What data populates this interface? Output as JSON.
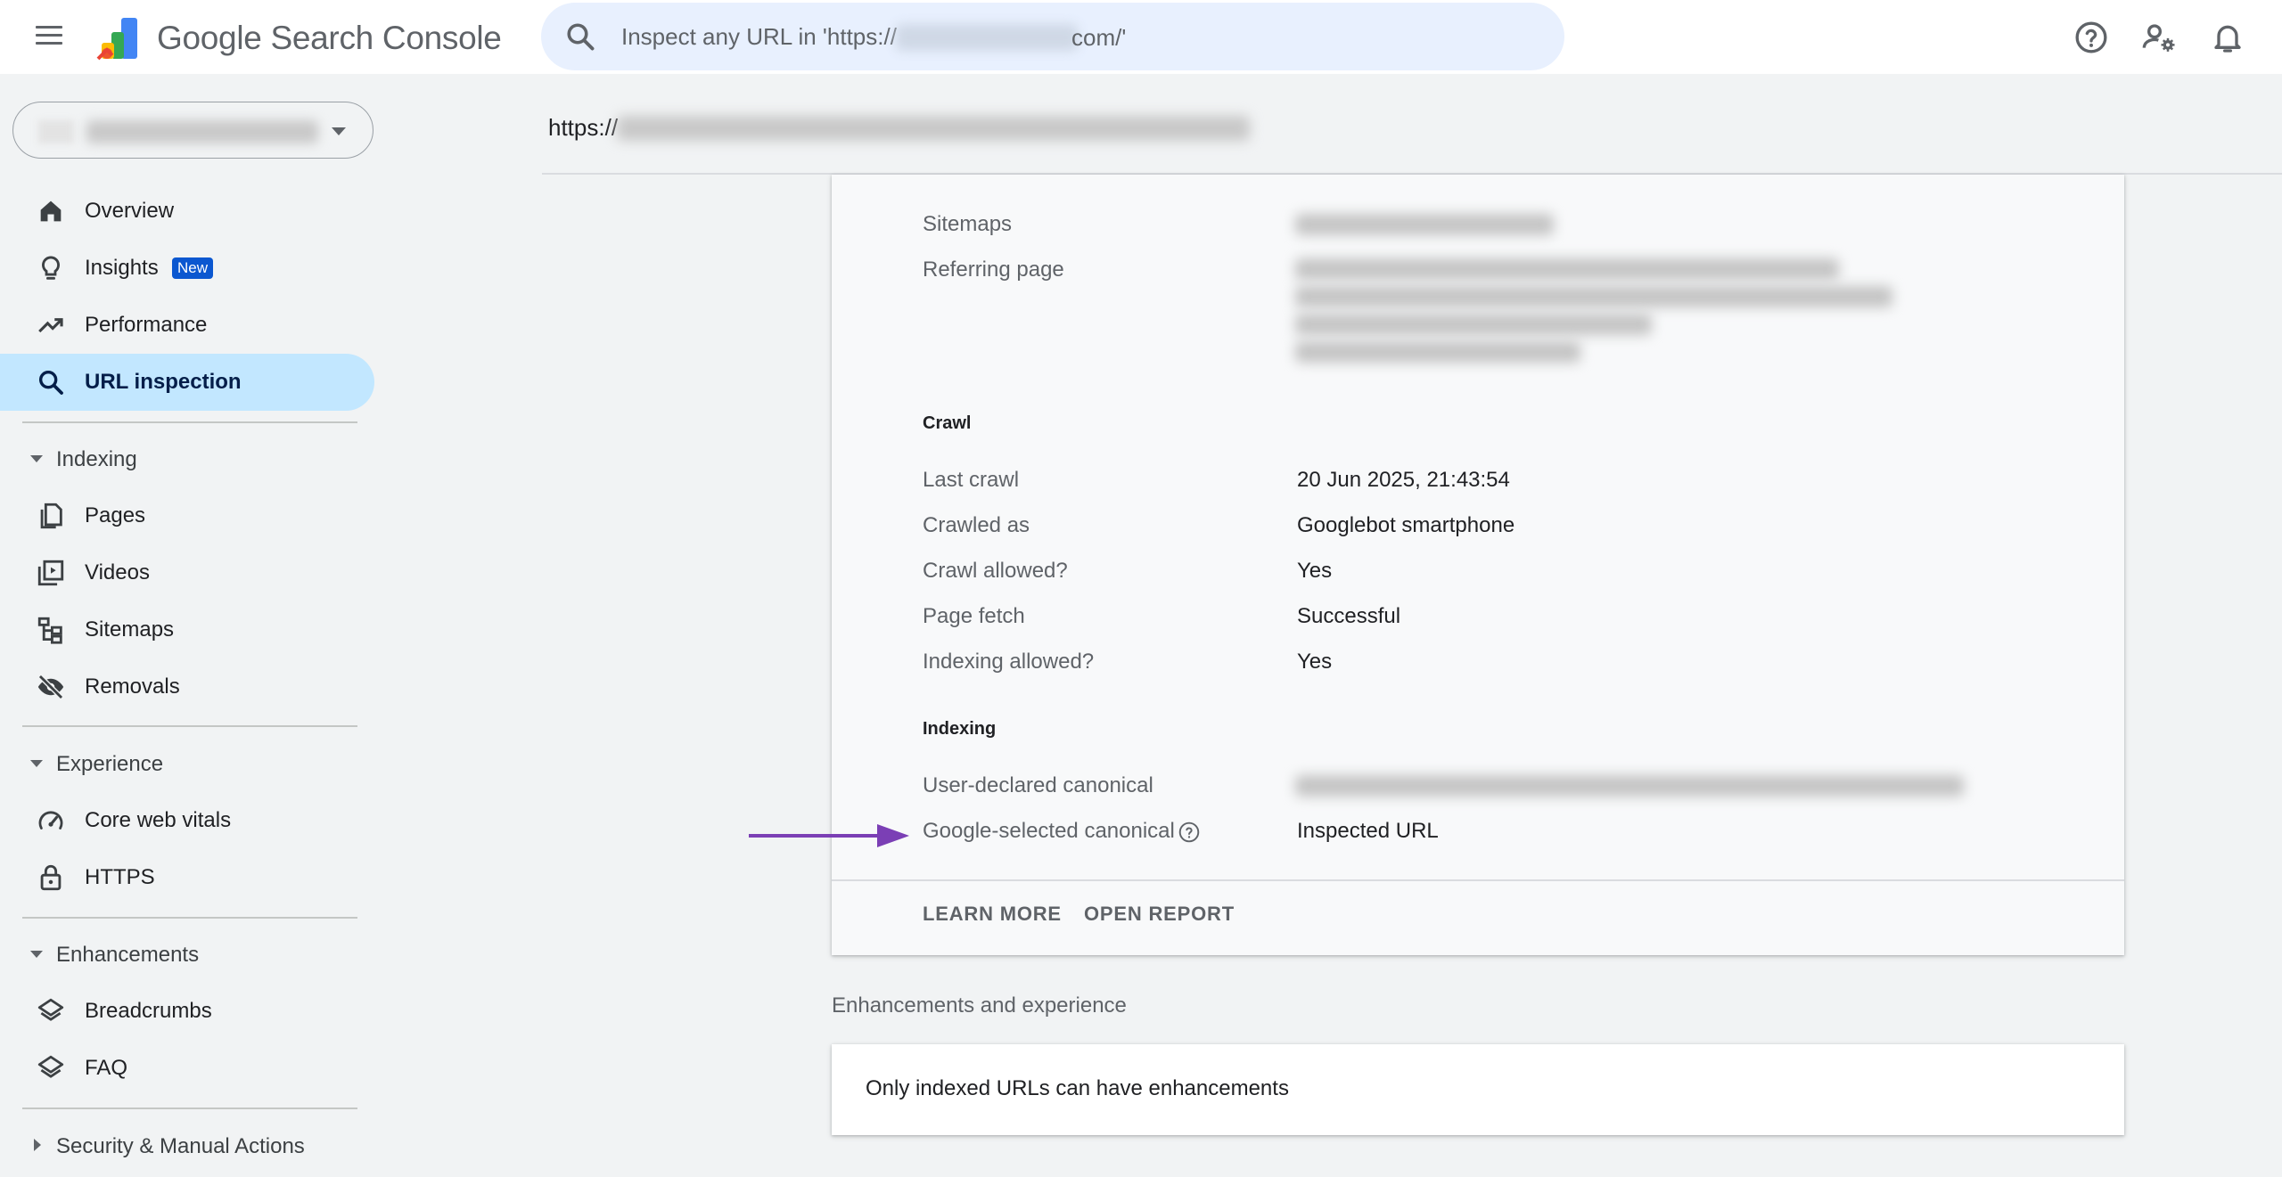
{
  "app": {
    "brand": "Google Search Console"
  },
  "search": {
    "placeholder": "Inspect any URL in 'https://",
    "placeholder_suffix": "com/'"
  },
  "url_bar": {
    "prefix": "https://"
  },
  "sidebar": {
    "items": [
      {
        "label": "Overview",
        "icon": "home-icon"
      },
      {
        "label": "Insights",
        "icon": "lightbulb-icon",
        "badge": "New"
      },
      {
        "label": "Performance",
        "icon": "trending-up-icon"
      },
      {
        "label": "URL inspection",
        "icon": "search-icon",
        "active": true
      }
    ],
    "sections": [
      {
        "label": "Indexing",
        "expanded": true,
        "items": [
          {
            "label": "Pages",
            "icon": "pages-icon"
          },
          {
            "label": "Videos",
            "icon": "video-library-icon"
          },
          {
            "label": "Sitemaps",
            "icon": "sitemap-icon"
          },
          {
            "label": "Removals",
            "icon": "visibility-off-icon"
          }
        ]
      },
      {
        "label": "Experience",
        "expanded": true,
        "items": [
          {
            "label": "Core web vitals",
            "icon": "speed-icon"
          },
          {
            "label": "HTTPS",
            "icon": "lock-icon"
          }
        ]
      },
      {
        "label": "Enhancements",
        "expanded": true,
        "items": [
          {
            "label": "Breadcrumbs",
            "icon": "layers-icon"
          },
          {
            "label": "FAQ",
            "icon": "layers-icon"
          }
        ]
      },
      {
        "label": "Security & Manual Actions",
        "expanded": false
      }
    ]
  },
  "details": {
    "discovery": {
      "sitemaps_label": "Sitemaps",
      "referring_label": "Referring page"
    },
    "crawl": {
      "title": "Crawl",
      "rows": [
        {
          "label": "Last crawl",
          "value": "20 Jun 2025, 21:43:54"
        },
        {
          "label": "Crawled as",
          "value": "Googlebot smartphone"
        },
        {
          "label": "Crawl allowed?",
          "value": "Yes"
        },
        {
          "label": "Page fetch",
          "value": "Successful"
        },
        {
          "label": "Indexing allowed?",
          "value": "Yes"
        }
      ]
    },
    "indexing": {
      "title": "Indexing",
      "user_canonical_label": "User-declared canonical",
      "google_canonical_label": "Google-selected canonical",
      "google_canonical_value": "Inspected URL"
    },
    "footer": {
      "learn_more": "LEARN MORE",
      "open_report": "OPEN REPORT"
    }
  },
  "enhancements": {
    "section_title": "Enhancements and experience",
    "message": "Only indexed URLs can have enhancements"
  },
  "colors": {
    "active_nav_bg": "#c2e7ff",
    "search_bg": "#e8f0fe",
    "badge_bg": "#0b57d0",
    "annotation_arrow": "#7b3fb5"
  }
}
